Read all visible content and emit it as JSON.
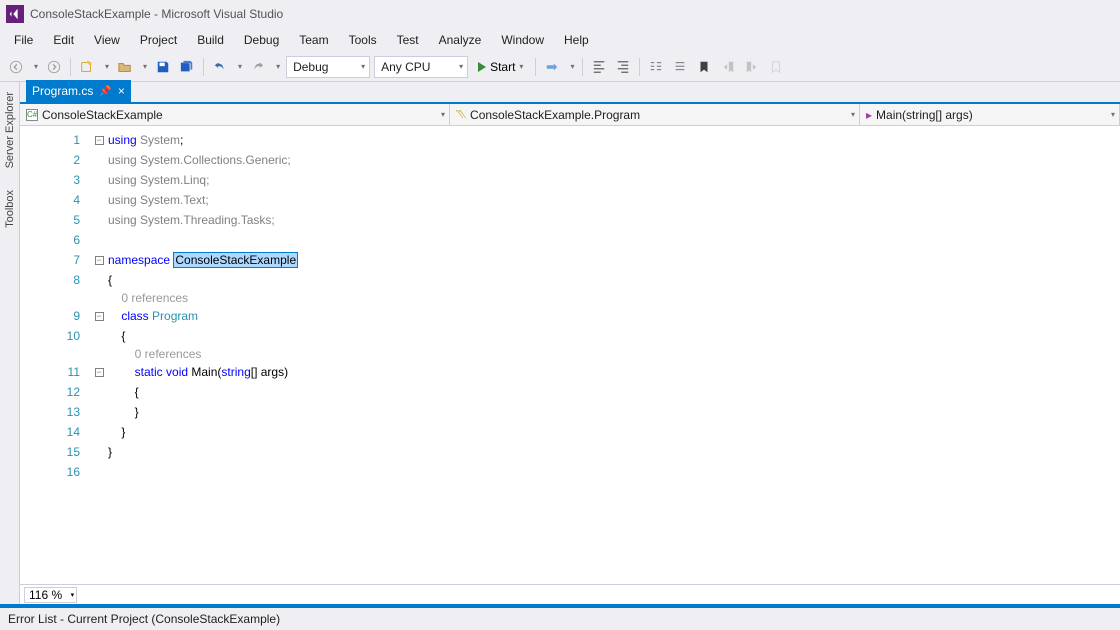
{
  "title": "ConsoleStackExample - Microsoft Visual Studio",
  "menu": [
    "File",
    "Edit",
    "View",
    "Project",
    "Build",
    "Debug",
    "Team",
    "Tools",
    "Test",
    "Analyze",
    "Window",
    "Help"
  ],
  "toolbar": {
    "config": "Debug",
    "platform": "Any CPU",
    "start": "Start"
  },
  "sideTabs": [
    "Server Explorer",
    "Toolbox"
  ],
  "docTab": {
    "label": "Program.cs"
  },
  "nav": {
    "project": "ConsoleStackExample",
    "class": "ConsoleStackExample.Program",
    "method": "Main(string[] args)"
  },
  "code": {
    "lines": [
      "1",
      "2",
      "3",
      "4",
      "5",
      "6",
      "7",
      "8",
      "9",
      "10",
      "11",
      "12",
      "13",
      "14",
      "15",
      "16"
    ],
    "using": "using",
    "systems": {
      "sys": "System",
      "collections": "System.Collections.Generic",
      "linq": "System.Linq",
      "text": "System.Text",
      "tasks": "System.Threading.Tasks"
    },
    "namespace_kw": "namespace",
    "namespace_name": "ConsoleStackExample",
    "class_kw": "class",
    "class_name": "Program",
    "static_kw": "static",
    "void_kw": "void",
    "main": "Main",
    "string_kw": "string",
    "args_sig": "[] args)",
    "refs": "0 references",
    "ob": "{",
    "cb": "}",
    "sc": ";",
    " ": " "
  },
  "zoom": "116 %",
  "status": "Error List - Current Project (ConsoleStackExample)"
}
